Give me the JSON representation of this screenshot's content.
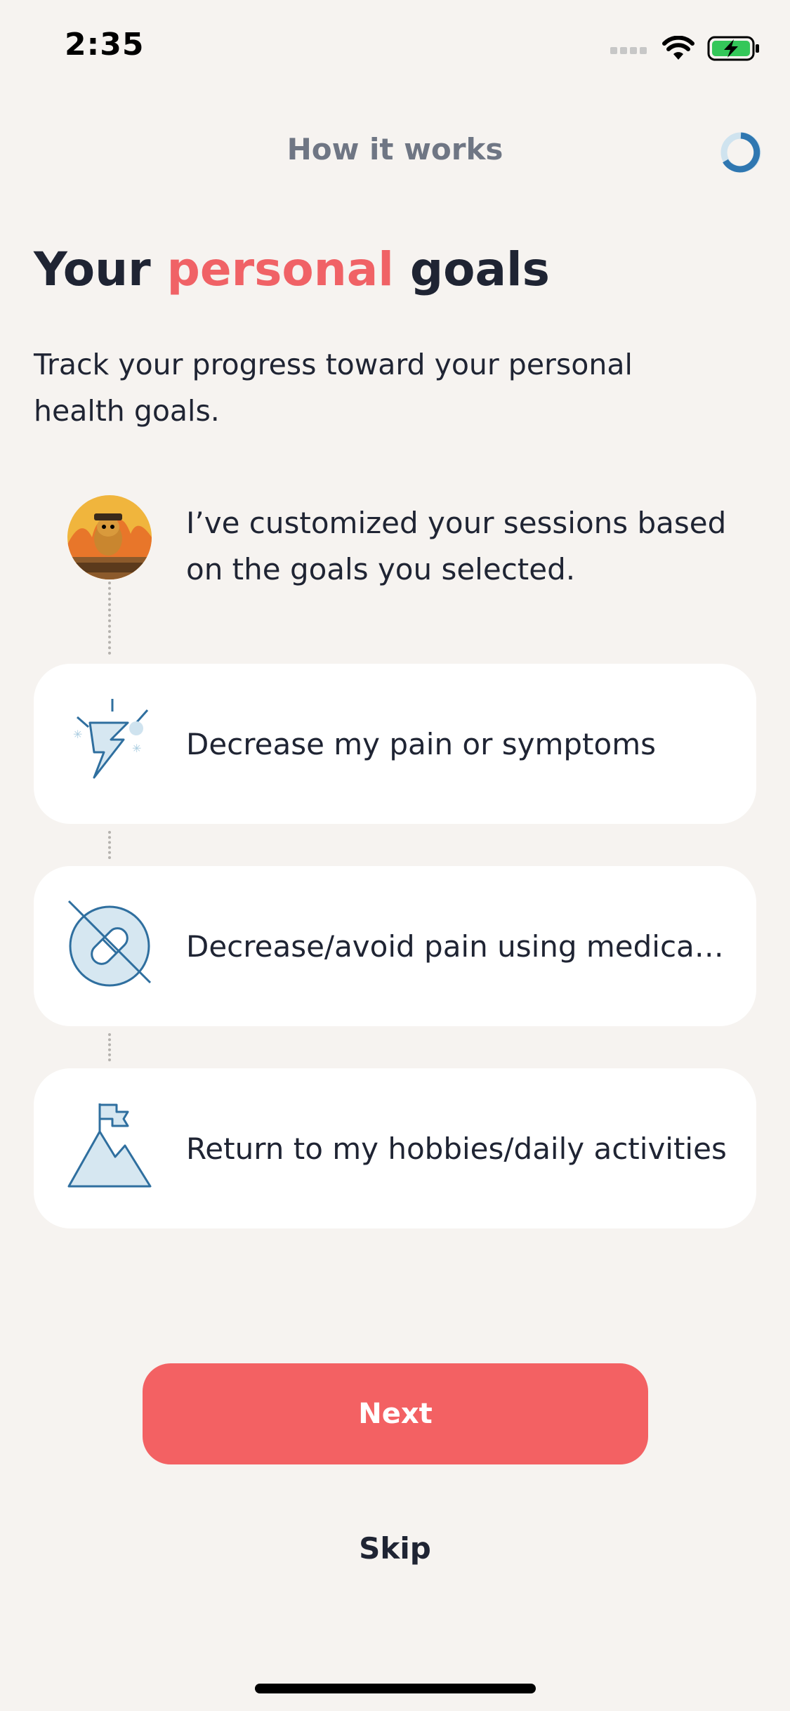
{
  "status_bar": {
    "time": "2:35",
    "icons": [
      "signal-icon",
      "wifi-icon",
      "battery-charging-icon"
    ],
    "battery_color": "#34c759"
  },
  "header": {
    "title": "How it works",
    "progress_ring_color": "#2f77b1"
  },
  "main": {
    "title_part1": "Your ",
    "title_accent": "personal",
    "title_part2": " goals",
    "subtitle": "Track your progress toward your personal health goals.",
    "coach_message": "I’ve customized your sessions based on the goals you selected.",
    "goals": [
      {
        "label": "Decrease my pain or symptoms",
        "icon": "lightning-icon"
      },
      {
        "label": "Decrease/avoid pain using medicat…",
        "icon": "no-pill-icon"
      },
      {
        "label": "Return to my hobbies/daily activities",
        "icon": "mountain-flag-icon"
      }
    ]
  },
  "actions": {
    "next_label": "Next",
    "skip_label": "Skip"
  },
  "colors": {
    "accent": "#f06266",
    "button": "#f36163",
    "background": "#f6f3f0",
    "icon_blue": "#2f6f9f"
  }
}
